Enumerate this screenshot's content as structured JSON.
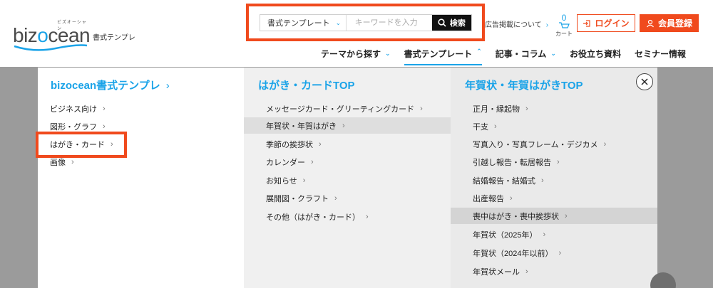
{
  "brand": {
    "logo_text_a": "biz",
    "logo_text_b": "o",
    "logo_text_c": "cean",
    "logo_kana": "ビズオーシャン",
    "subtitle": "書式テンプレ"
  },
  "search": {
    "category": "書式テンプレート",
    "placeholder": "キーワードを入力",
    "button_label": "検索"
  },
  "header_links": {
    "ad_link": "広告掲載について",
    "cart_count": "0",
    "cart_label": "カート",
    "login_label": "ログイン",
    "register_label": "会員登録"
  },
  "nav": [
    {
      "label": "テーマから探す"
    },
    {
      "label": "書式テンプレート"
    },
    {
      "label": "記事・コラム"
    },
    {
      "label": "お役立ち資料"
    },
    {
      "label": "セミナー情報"
    }
  ],
  "mega_menu": {
    "col1": {
      "title": "bizocean書式テンプレ",
      "items": [
        {
          "label": "ビジネス向け"
        },
        {
          "label": "図形・グラフ"
        },
        {
          "label": "はがき・カード"
        },
        {
          "label": "画像"
        }
      ]
    },
    "col2": {
      "title": "はがき・カードTOP",
      "items": [
        {
          "label": "メッセージカード・グリーティングカード"
        },
        {
          "label": "年賀状・年賀はがき"
        },
        {
          "label": "季節の挨拶状"
        },
        {
          "label": "カレンダー"
        },
        {
          "label": "お知らせ"
        },
        {
          "label": "展開図・クラフト"
        },
        {
          "label": "その他（はがき・カード）"
        }
      ]
    },
    "col3": {
      "title": "年賀状・年賀はがきTOP",
      "items": [
        {
          "label": "正月・縁起物"
        },
        {
          "label": "干支"
        },
        {
          "label": "写真入り・写真フレーム・デジカメ"
        },
        {
          "label": "引越し報告・転居報告"
        },
        {
          "label": "結婚報告・結婚式"
        },
        {
          "label": "出産報告"
        },
        {
          "label": "喪中はがき・喪中挨拶状"
        },
        {
          "label": "年賀状（2025年）"
        },
        {
          "label": "年賀状（2024年以前）"
        },
        {
          "label": "年賀状メール"
        }
      ]
    }
  },
  "colors": {
    "accent": "#1aa3e8",
    "brand_orange": "#f04a1d",
    "overlay": "#9b9b9b"
  }
}
